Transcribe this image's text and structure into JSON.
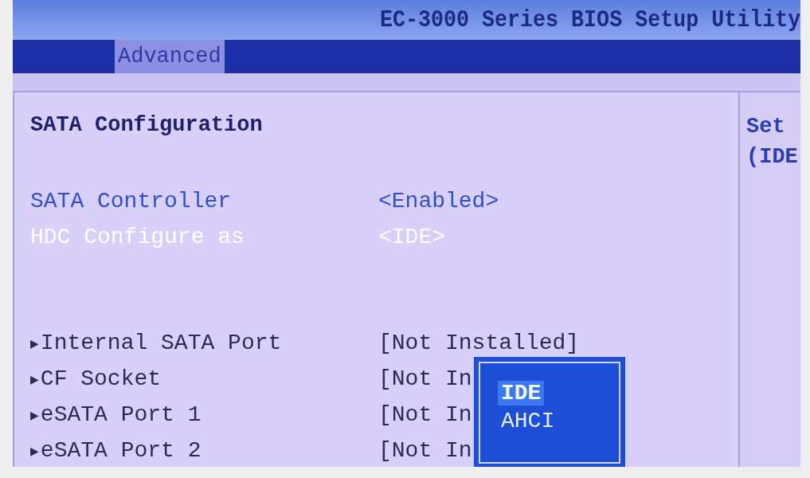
{
  "window": {
    "title": "EC-3000 Series BIOS Setup Utility"
  },
  "tabs": [
    {
      "label": "Advanced",
      "selected": true
    }
  ],
  "section": {
    "title": "SATA Configuration"
  },
  "items": [
    {
      "kind": "setting",
      "label": "SATA Controller",
      "value": "<Enabled>",
      "selected": false
    },
    {
      "kind": "setting",
      "label": "HDC Configure as",
      "value": "<IDE>",
      "selected": true
    },
    {
      "kind": "gap"
    },
    {
      "kind": "submenu",
      "marker": "▶",
      "label": "Internal SATA Port",
      "value": "[Not Installed]",
      "selected": false
    },
    {
      "kind": "submenu",
      "marker": "▶",
      "label": "CF Socket",
      "value": "[Not In",
      "selected": false
    },
    {
      "kind": "submenu",
      "marker": "▶",
      "label": "eSATA Port 1",
      "value": "[Not In",
      "selected": false
    },
    {
      "kind": "submenu",
      "marker": "▶",
      "label": "eSATA Port 2",
      "value": "[Not In",
      "selected": false
    }
  ],
  "popup": {
    "options": [
      {
        "label": "IDE",
        "selected": true
      },
      {
        "label": "AHCI",
        "selected": false
      }
    ]
  },
  "help": {
    "lines": [
      "Set",
      "(IDE"
    ]
  }
}
